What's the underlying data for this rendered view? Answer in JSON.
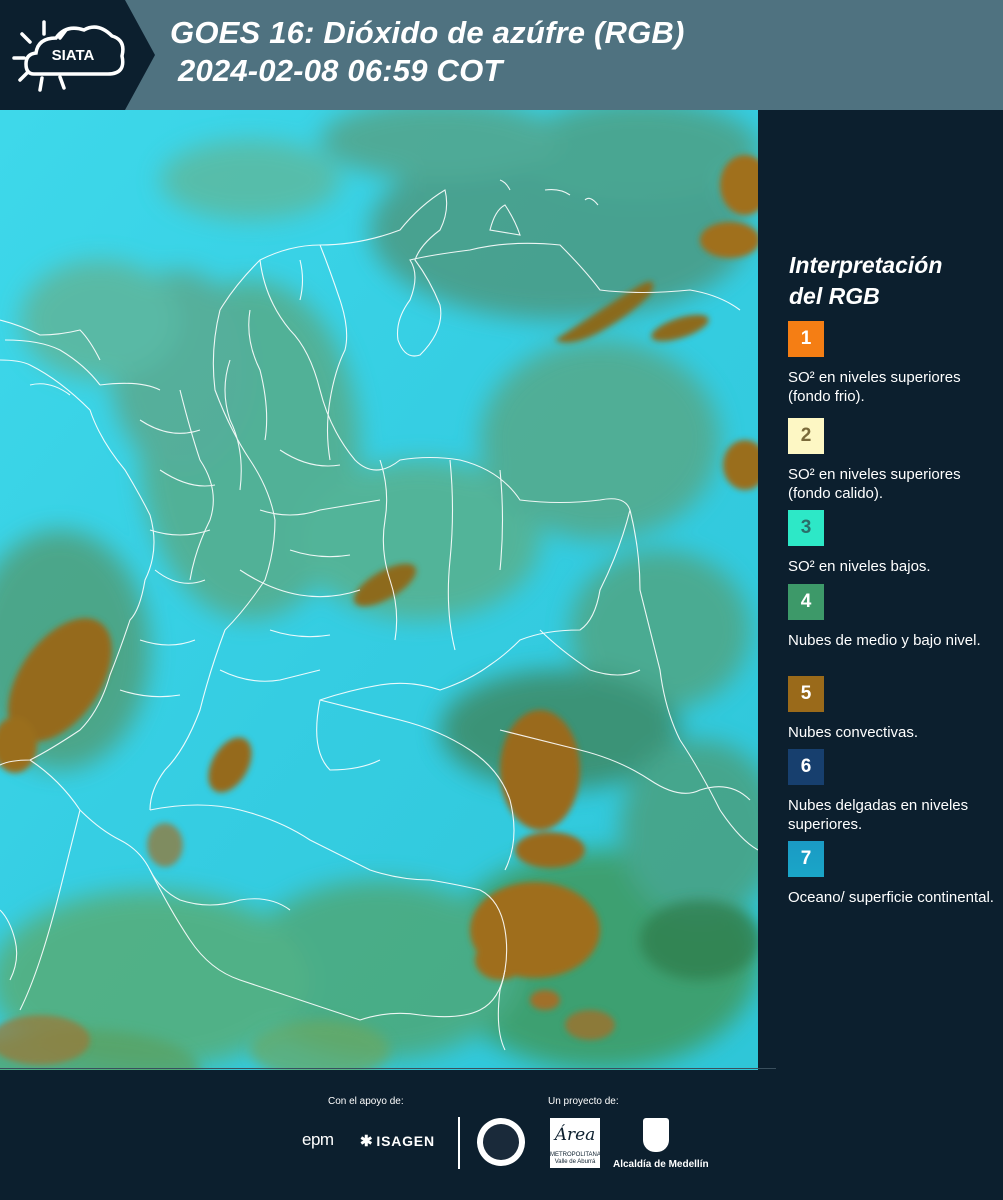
{
  "header": {
    "logo_text": "SIATA",
    "title_line1": "GOES 16: Dióxido de azúfre (RGB)",
    "title_line2": "2024-02-08 06:59 COT"
  },
  "legend": {
    "title_line1": "Interpretación",
    "title_line2": "del RGB",
    "items": [
      {
        "num": "1",
        "color": "#f57e14",
        "text": "SO² en niveles superiores (fondo frio)."
      },
      {
        "num": "2",
        "color": "#fdf7c4",
        "num_color": "#7a6a3a",
        "text": "SO² en niveles superiores (fondo calido)."
      },
      {
        "num": "3",
        "color": "#2de8c7",
        "num_color": "#2a6f6a",
        "text": "SO² en niveles bajos."
      },
      {
        "num": "4",
        "color": "#3d9969",
        "text": "Nubes de medio y bajo nivel."
      },
      {
        "num": "5",
        "color": "#9a6a1a",
        "text": "Nubes convectivas."
      },
      {
        "num": "6",
        "color": "#173f6e",
        "text": "Nubes delgadas en niveles superiores."
      },
      {
        "num": "7",
        "color": "#1aa0c4",
        "text": "Oceano/ superficie continental."
      }
    ]
  },
  "footer": {
    "support_label": "Con el apoyo de:",
    "project_label": "Un proyecto de:",
    "epm": "epm",
    "isagen": "ISAGEN",
    "area_name": "Área",
    "area_sub": "METROPOLITANA Valle de Aburrá",
    "alcaldia": "Alcaldía de Medellín"
  },
  "colors": {
    "header_bg": "#4f7280",
    "background": "#0c1f2e",
    "map_sky": "#36cfe3",
    "land_cloud_green": "#4fa27a",
    "convective": "#9a6a1a"
  }
}
